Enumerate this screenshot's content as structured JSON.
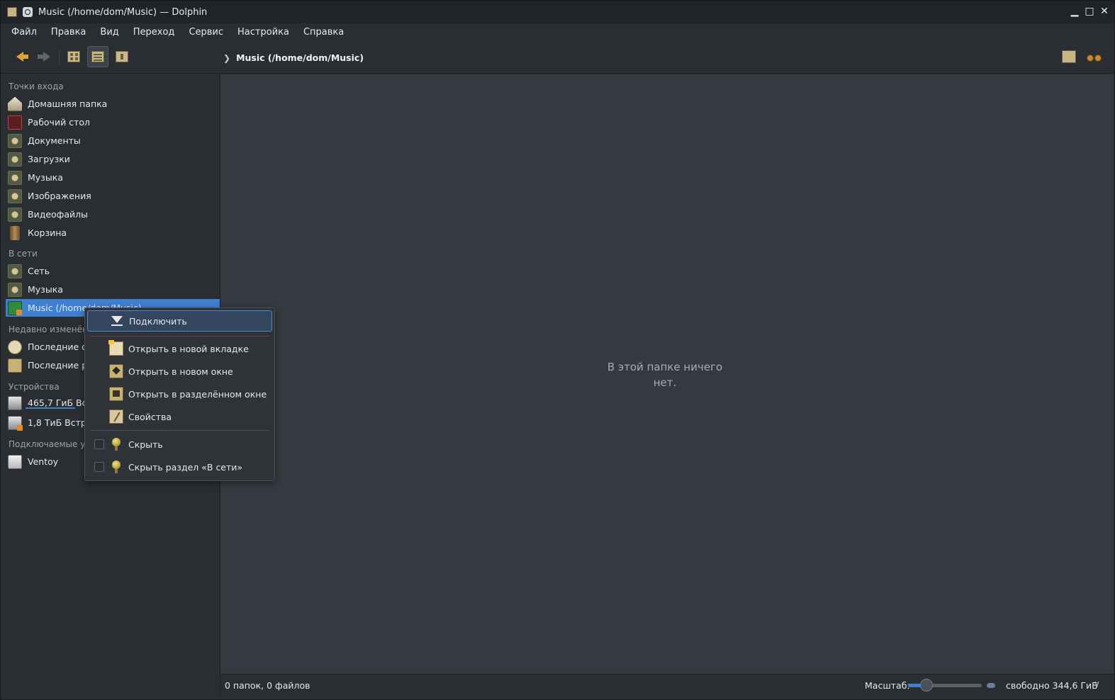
{
  "window": {
    "title": "Music (/home/dom/Music) — Dolphin",
    "buttons": [
      "minimize",
      "maximize",
      "close"
    ]
  },
  "menubar": {
    "items": [
      "Файл",
      "Правка",
      "Вид",
      "Переход",
      "Сервис",
      "Настройка",
      "Справка"
    ]
  },
  "toolbar": {
    "breadcrumb": "Music (/home/dom/Music)",
    "view_modes": [
      "icons",
      "details",
      "compact"
    ],
    "active_view": "details"
  },
  "sidebar": {
    "sections": {
      "places": "Точки входа",
      "network": "В сети",
      "recent": "Недавно изменён",
      "devices": "Устройства",
      "removable": "Подключаемые ус"
    },
    "places": [
      {
        "label": "Домашняя папка",
        "icon": "home-folder-icon"
      },
      {
        "label": "Рабочий стол",
        "icon": "desktop-icon"
      },
      {
        "label": "Документы",
        "icon": "documents-folder-icon"
      },
      {
        "label": "Загрузки",
        "icon": "downloads-folder-icon"
      },
      {
        "label": "Музыка",
        "icon": "music-folder-icon"
      },
      {
        "label": "Изображения",
        "icon": "pictures-folder-icon"
      },
      {
        "label": "Видеофайлы",
        "icon": "videos-folder-icon"
      },
      {
        "label": "Корзина",
        "icon": "trash-icon"
      }
    ],
    "network": [
      {
        "label": "Сеть",
        "icon": "network-folder-icon"
      },
      {
        "label": "Музыка",
        "icon": "network-music-icon"
      },
      {
        "label": "Music (/home/dom/Music)",
        "icon": "music-mount-icon"
      }
    ],
    "recent": [
      {
        "label": "Последние фа",
        "icon": "recent-files-icon"
      },
      {
        "label": "Последние ра",
        "icon": "recent-locations-icon"
      }
    ],
    "devices": [
      {
        "label": "465,7 ГиБ Встр",
        "icon": "hard-drive-icon",
        "usage": 0.26
      },
      {
        "label": "1,8 ТиБ Встрое",
        "icon": "hard-drive-icon"
      }
    ],
    "removable": [
      {
        "label": "Ventoy",
        "icon": "usb-drive-icon"
      }
    ]
  },
  "context_menu": {
    "mount": "Подключить",
    "open_new_tab": "Открыть в новой вкладке",
    "open_new_window": "Открыть в новом окне",
    "open_split": "Открыть в разделённом окне",
    "properties": "Свойства",
    "hide": "Скрыть",
    "hide_section": "Скрыть раздел «В сети»"
  },
  "main": {
    "empty_message": "В этой папке ничего нет."
  },
  "statusbar": {
    "summary": "0 папок, 0 файлов",
    "zoom_label": "Масштаб:",
    "zoom_level": 0.25,
    "free_space": "свободно 344,6 ГиБ"
  },
  "colors": {
    "accent": "#3f7fd0",
    "background": "#353a41",
    "panel": "#2a2e33"
  }
}
